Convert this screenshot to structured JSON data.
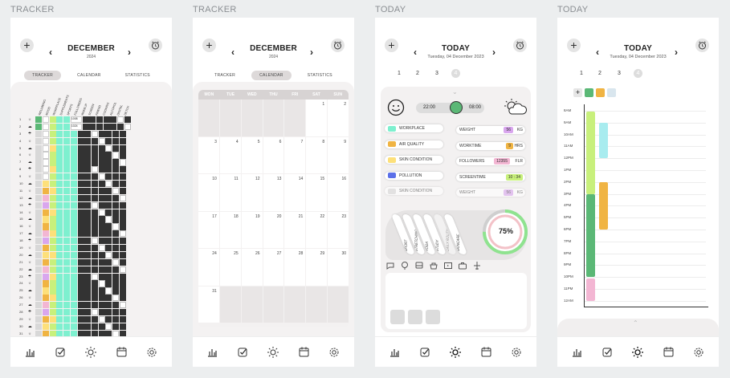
{
  "labels": [
    "TRACKER",
    "TRACKER",
    "TODAY",
    "TODAY"
  ],
  "tracker": {
    "month": "DECEMBER",
    "year": "2024",
    "tabs": [
      "TRACKER",
      "CALENDAR",
      "STATISTICS"
    ],
    "columns": [
      "WELLBEING",
      "MOOD",
      "WORKPLACE",
      "SUPPLEMENTS",
      "SPORTS",
      "FOLLOWERS",
      "WAKEUP",
      "SCREEN",
      "FRIEND",
      "COOKING",
      "ALCOHOL",
      "DIGITAL",
      "DETOX"
    ],
    "values": [
      "1008",
      "1024"
    ],
    "days": [
      "1",
      "2",
      "3",
      "4",
      "5",
      "6",
      "7",
      "8",
      "9",
      "10",
      "11",
      "12",
      "13",
      "14",
      "15",
      "16",
      "17",
      "18",
      "19",
      "20",
      "21",
      "22",
      "23",
      "24",
      "25",
      "26",
      "27",
      "28",
      "29",
      "30",
      "31"
    ]
  },
  "calendar": {
    "month": "DECEMBER",
    "year": "2024",
    "tabs": [
      "TRACKER",
      "CALENDAR",
      "STATISTICS"
    ],
    "weekdays": [
      "MON",
      "TUE",
      "WED",
      "THU",
      "FRI",
      "SAT",
      "SUN"
    ],
    "cells": [
      "",
      "",
      "",
      "",
      "",
      "1",
      "2",
      "3",
      "4",
      "5",
      "6",
      "7",
      "8",
      "9",
      "10",
      "11",
      "12",
      "13",
      "14",
      "15",
      "16",
      "17",
      "18",
      "19",
      "20",
      "21",
      "22",
      "23",
      "24",
      "25",
      "26",
      "27",
      "28",
      "29",
      "30",
      "31",
      "",
      "",
      "",
      "",
      "",
      ""
    ]
  },
  "today": {
    "title": "TODAY",
    "date": "Tuesday, 04 December 2023",
    "pages": [
      "1",
      "2",
      "3",
      "4"
    ],
    "sleep_start": "22:00",
    "sleep_end": "08:00",
    "trackers": [
      "WORKPLACE",
      "AIR QUALITY",
      "SKIN CONDITION",
      "POLLUTION",
      "SKIN CONDITION"
    ],
    "tracker_colors": [
      "#7ef0cf",
      "#f0b443",
      "#fde07a",
      "#5b70e8",
      "#d8d8d8"
    ],
    "metrics": [
      {
        "label": "WEIGHT",
        "value": "56",
        "unit": "KG",
        "color": "#d9a6ee"
      },
      {
        "label": "WORKTIME",
        "value": "9",
        "unit": "HRS",
        "color": "#f0b443"
      },
      {
        "label": "FOLLOWERS",
        "value": "12355",
        "unit": "FLR",
        "color": "#f3b6d3"
      },
      {
        "label": "SCREENTIME",
        "value": "10",
        "value2": "34",
        "unit": "",
        "color": "#c8f07c"
      },
      {
        "label": "WEIGHT",
        "value": "56",
        "unit": "KG",
        "color": "#d9a6ee"
      }
    ],
    "activities": [
      "SPORT",
      "STRETCHING",
      "YOGA",
      "STUDY",
      "DAILY ROUTINE",
      "SKINCARE"
    ],
    "progress": "75%",
    "progress_value": 0.75
  },
  "schedule": {
    "title": "TODAY",
    "date": "Tuesday, 04 December 2023",
    "pages": [
      "1",
      "2",
      "3",
      "4"
    ],
    "hours": [
      "8AM",
      "9AM",
      "10AM",
      "11AM",
      "12PM",
      "1PM",
      "2PM",
      "3PM",
      "4PM",
      "5PM",
      "6PM",
      "7PM",
      "8PM",
      "9PM",
      "10PM",
      "11PM",
      "12AM"
    ]
  }
}
